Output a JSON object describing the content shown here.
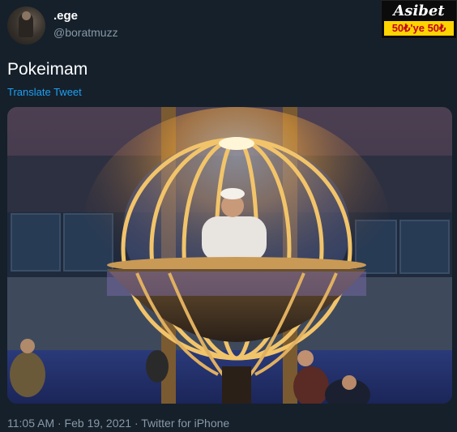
{
  "author": {
    "display_name": ".ege",
    "handle": "@boratmuzz"
  },
  "ad": {
    "brand": "Asibet",
    "promo": "50₺'ye 50₺"
  },
  "tweet": {
    "text": "Pokeimam",
    "translate_label": "Translate Tweet"
  },
  "footer": {
    "meta": "11:05 AM · Feb 19, 2021 · Twitter for iPhone"
  },
  "icons": {
    "avatar": "user-avatar",
    "media": "tweet-photo"
  }
}
